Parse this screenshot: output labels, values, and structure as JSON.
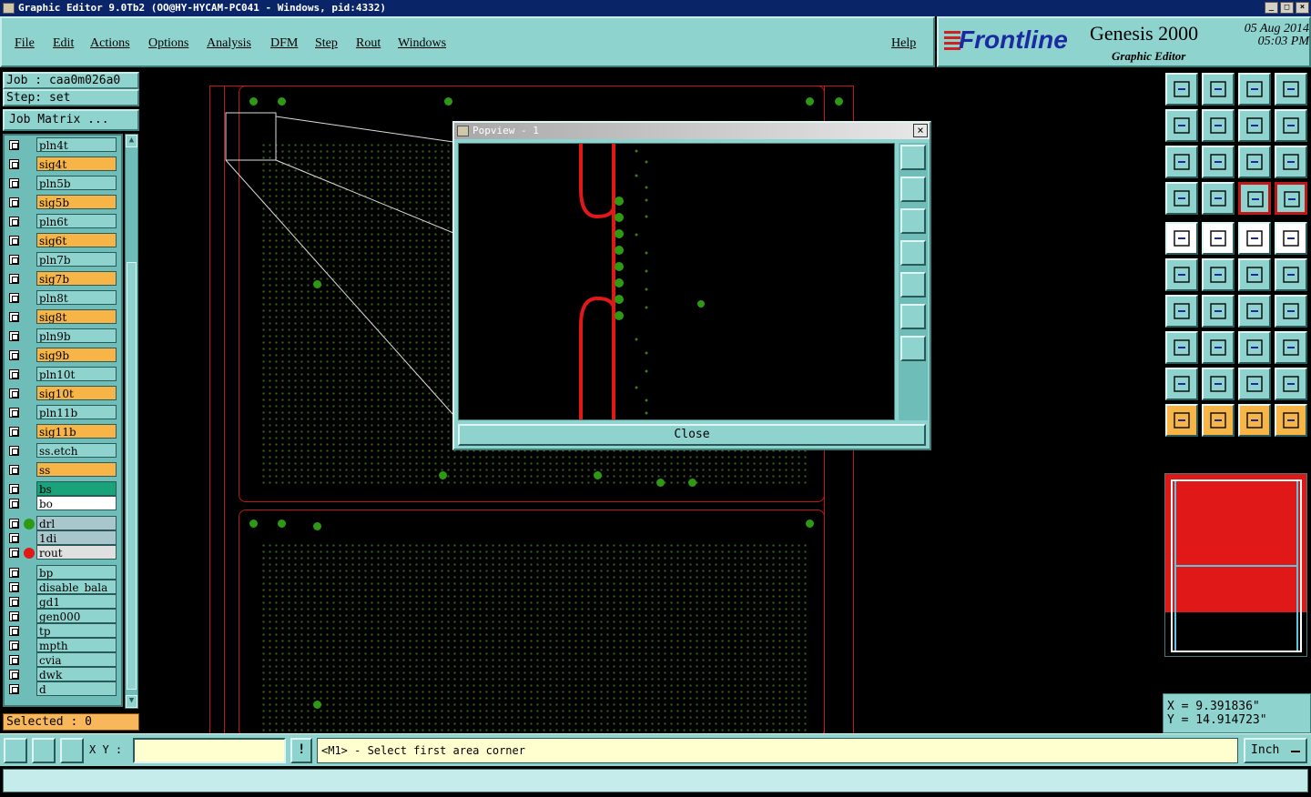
{
  "window": {
    "title": "Graphic Editor 9.0Tb2  (OO@HY-HYCAM-PC041 - Windows, pid:4332)"
  },
  "menu": {
    "file": "File",
    "edit": "Edit",
    "actions": "Actions",
    "options": "Options",
    "analysis": "Analysis",
    "dfm": "DFM",
    "step": "Step",
    "rout": "Rout",
    "windows": "Windows",
    "help": "Help"
  },
  "brand": {
    "logo": "Frontline",
    "product": "Genesis 2000",
    "subtitle": "Graphic Editor",
    "date": "05 Aug 2014",
    "time": "05:03 PM"
  },
  "job": {
    "name": "Job : caa0m026a0",
    "step": "Step: set",
    "matrix_button": "Job Matrix ..."
  },
  "layers": [
    {
      "name": "pln4t",
      "color": "#8fd3cf"
    },
    {
      "name": "sig4t",
      "color": "#f7b548"
    },
    {
      "name": "pln5b",
      "color": "#8fd3cf"
    },
    {
      "name": "sig5b",
      "color": "#f7b548"
    },
    {
      "name": "pln6t",
      "color": "#8fd3cf"
    },
    {
      "name": "sig6t",
      "color": "#f7b548"
    },
    {
      "name": "pln7b",
      "color": "#8fd3cf"
    },
    {
      "name": "sig7b",
      "color": "#f7b548"
    },
    {
      "name": "pln8t",
      "color": "#8fd3cf"
    },
    {
      "name": "sig8t",
      "color": "#f7b548"
    },
    {
      "name": "pln9b",
      "color": "#8fd3cf"
    },
    {
      "name": "sig9b",
      "color": "#f7b548"
    },
    {
      "name": "pln10t",
      "color": "#8fd3cf"
    },
    {
      "name": "sig10t",
      "color": "#f7b548"
    },
    {
      "name": "pln11b",
      "color": "#8fd3cf"
    },
    {
      "name": "sig11b",
      "color": "#f7b548"
    },
    {
      "name": "ss.etch",
      "color": "#8fd3cf"
    },
    {
      "name": "ss",
      "color": "#f7b548"
    },
    {
      "name": "bs",
      "color": "#1aa27a"
    },
    {
      "name": "bo",
      "color": "#ffffff"
    },
    {
      "name": "drl",
      "color": "#a9c6cc",
      "dot": "#2e9a14"
    },
    {
      "name": "1di",
      "color": "#a9c6cc"
    },
    {
      "name": "rout",
      "color": "#e0e0e0",
      "dot": "#e01818"
    },
    {
      "name": "bp",
      "color": "#8fd3cf"
    },
    {
      "name": "disable_bala",
      "color": "#8fd3cf"
    },
    {
      "name": "gd1",
      "color": "#8fd3cf"
    },
    {
      "name": "gen000",
      "color": "#8fd3cf"
    },
    {
      "name": "tp",
      "color": "#8fd3cf"
    },
    {
      "name": "mpth",
      "color": "#8fd3cf"
    },
    {
      "name": "cvia",
      "color": "#8fd3cf"
    },
    {
      "name": "dwk",
      "color": "#8fd3cf"
    },
    {
      "name": "d",
      "color": "#8fd3cf"
    }
  ],
  "selection": {
    "text": "Selected : 0"
  },
  "popview": {
    "title": "Popview - 1",
    "close_label": "Close",
    "close_x": "×"
  },
  "coordinates": {
    "x": "X = 9.391836\"",
    "y": "Y = 14.914723\""
  },
  "statusbar": {
    "xy_label": "X Y :",
    "xy_value": "",
    "prompt": "<M1> - Select first area corner",
    "units": "Inch"
  },
  "colors": {
    "panel": "#8fd3cf",
    "layer_signal": "#f7b548",
    "trace": "#e01818",
    "pad": "#2e9a14"
  }
}
